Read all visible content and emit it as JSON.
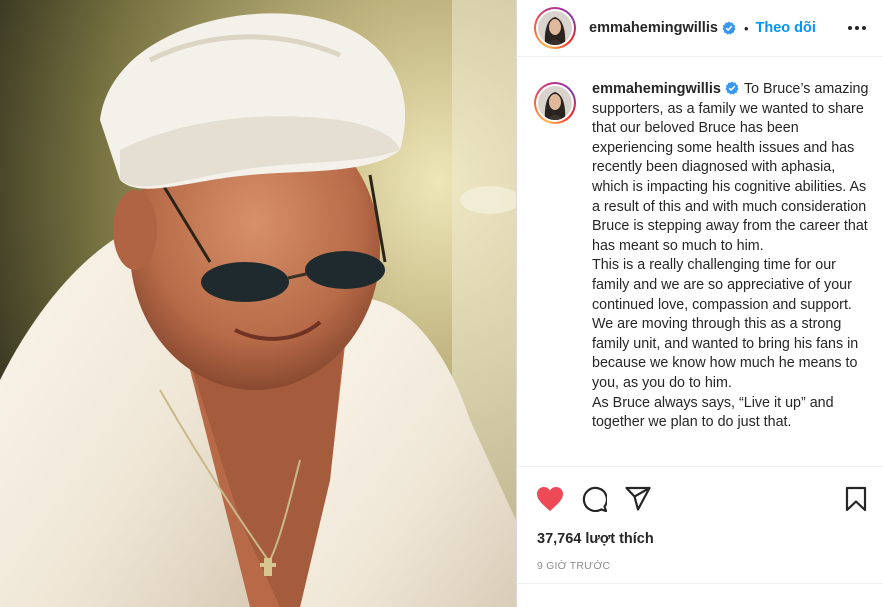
{
  "post": {
    "username": "emmahemingwillis",
    "follow_label": "Theo dõi",
    "separator": "•",
    "caption": "To Bruce’s amazing supporters, as a family we wanted to share that our beloved Bruce has been experiencing some health issues and has recently been diagnosed with aphasia, which is impacting his cognitive abilities. As a result of this and with much consideration Bruce is stepping away from the career that has meant so much to him.\nThis is a really challenging time for our family and we are so appreciative of your continued love, compassion and support. We are moving through this as a strong family unit, and wanted to bring his fans in because we know how much he means to you, as you do to him.\nAs Bruce always says, “Live it up” and together we plan to do just that.",
    "likes": "37,764 lượt thích",
    "timestamp": "9 GIỜ TRƯỚC"
  },
  "icons": {
    "verified": "verified-badge-icon",
    "more": "more-options-icon",
    "like": "heart-icon",
    "comment": "comment-icon",
    "share": "share-icon",
    "save": "bookmark-icon"
  },
  "colors": {
    "link": "#0095f6",
    "like": "#ed4956",
    "verified": "#3897f0",
    "muted": "#8e8e8e"
  }
}
